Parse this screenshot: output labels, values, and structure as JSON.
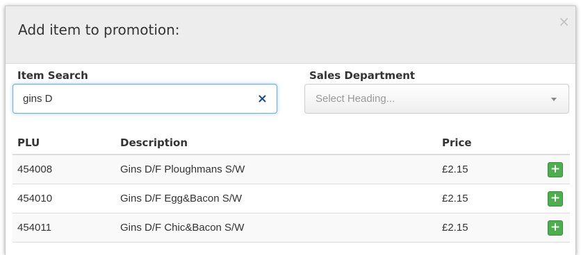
{
  "modal": {
    "title": "Add item to promotion:",
    "close_glyph": "×"
  },
  "item_search": {
    "label": "Item Search",
    "value": "gins D",
    "clear_glyph": "×"
  },
  "sales_department": {
    "label": "Sales Department",
    "placeholder": "Select Heading..."
  },
  "table": {
    "headers": {
      "plu": "PLU",
      "description": "Description",
      "price": "Price"
    },
    "rows": [
      {
        "plu": "454008",
        "description": "Gins D/F Ploughmans S/W",
        "price": "£2.15",
        "add_glyph": "+"
      },
      {
        "plu": "454010",
        "description": "Gins D/F Egg&Bacon S/W",
        "price": "£2.15",
        "add_glyph": "+"
      },
      {
        "plu": "454011",
        "description": "Gins D/F Chic&Bacon S/W",
        "price": "£2.15",
        "add_glyph": "+"
      }
    ]
  },
  "colors": {
    "header_bg": "#ededed",
    "focus_border": "#66afe9",
    "add_button": "#4cae4c",
    "clear_icon": "#1a4e8a"
  }
}
